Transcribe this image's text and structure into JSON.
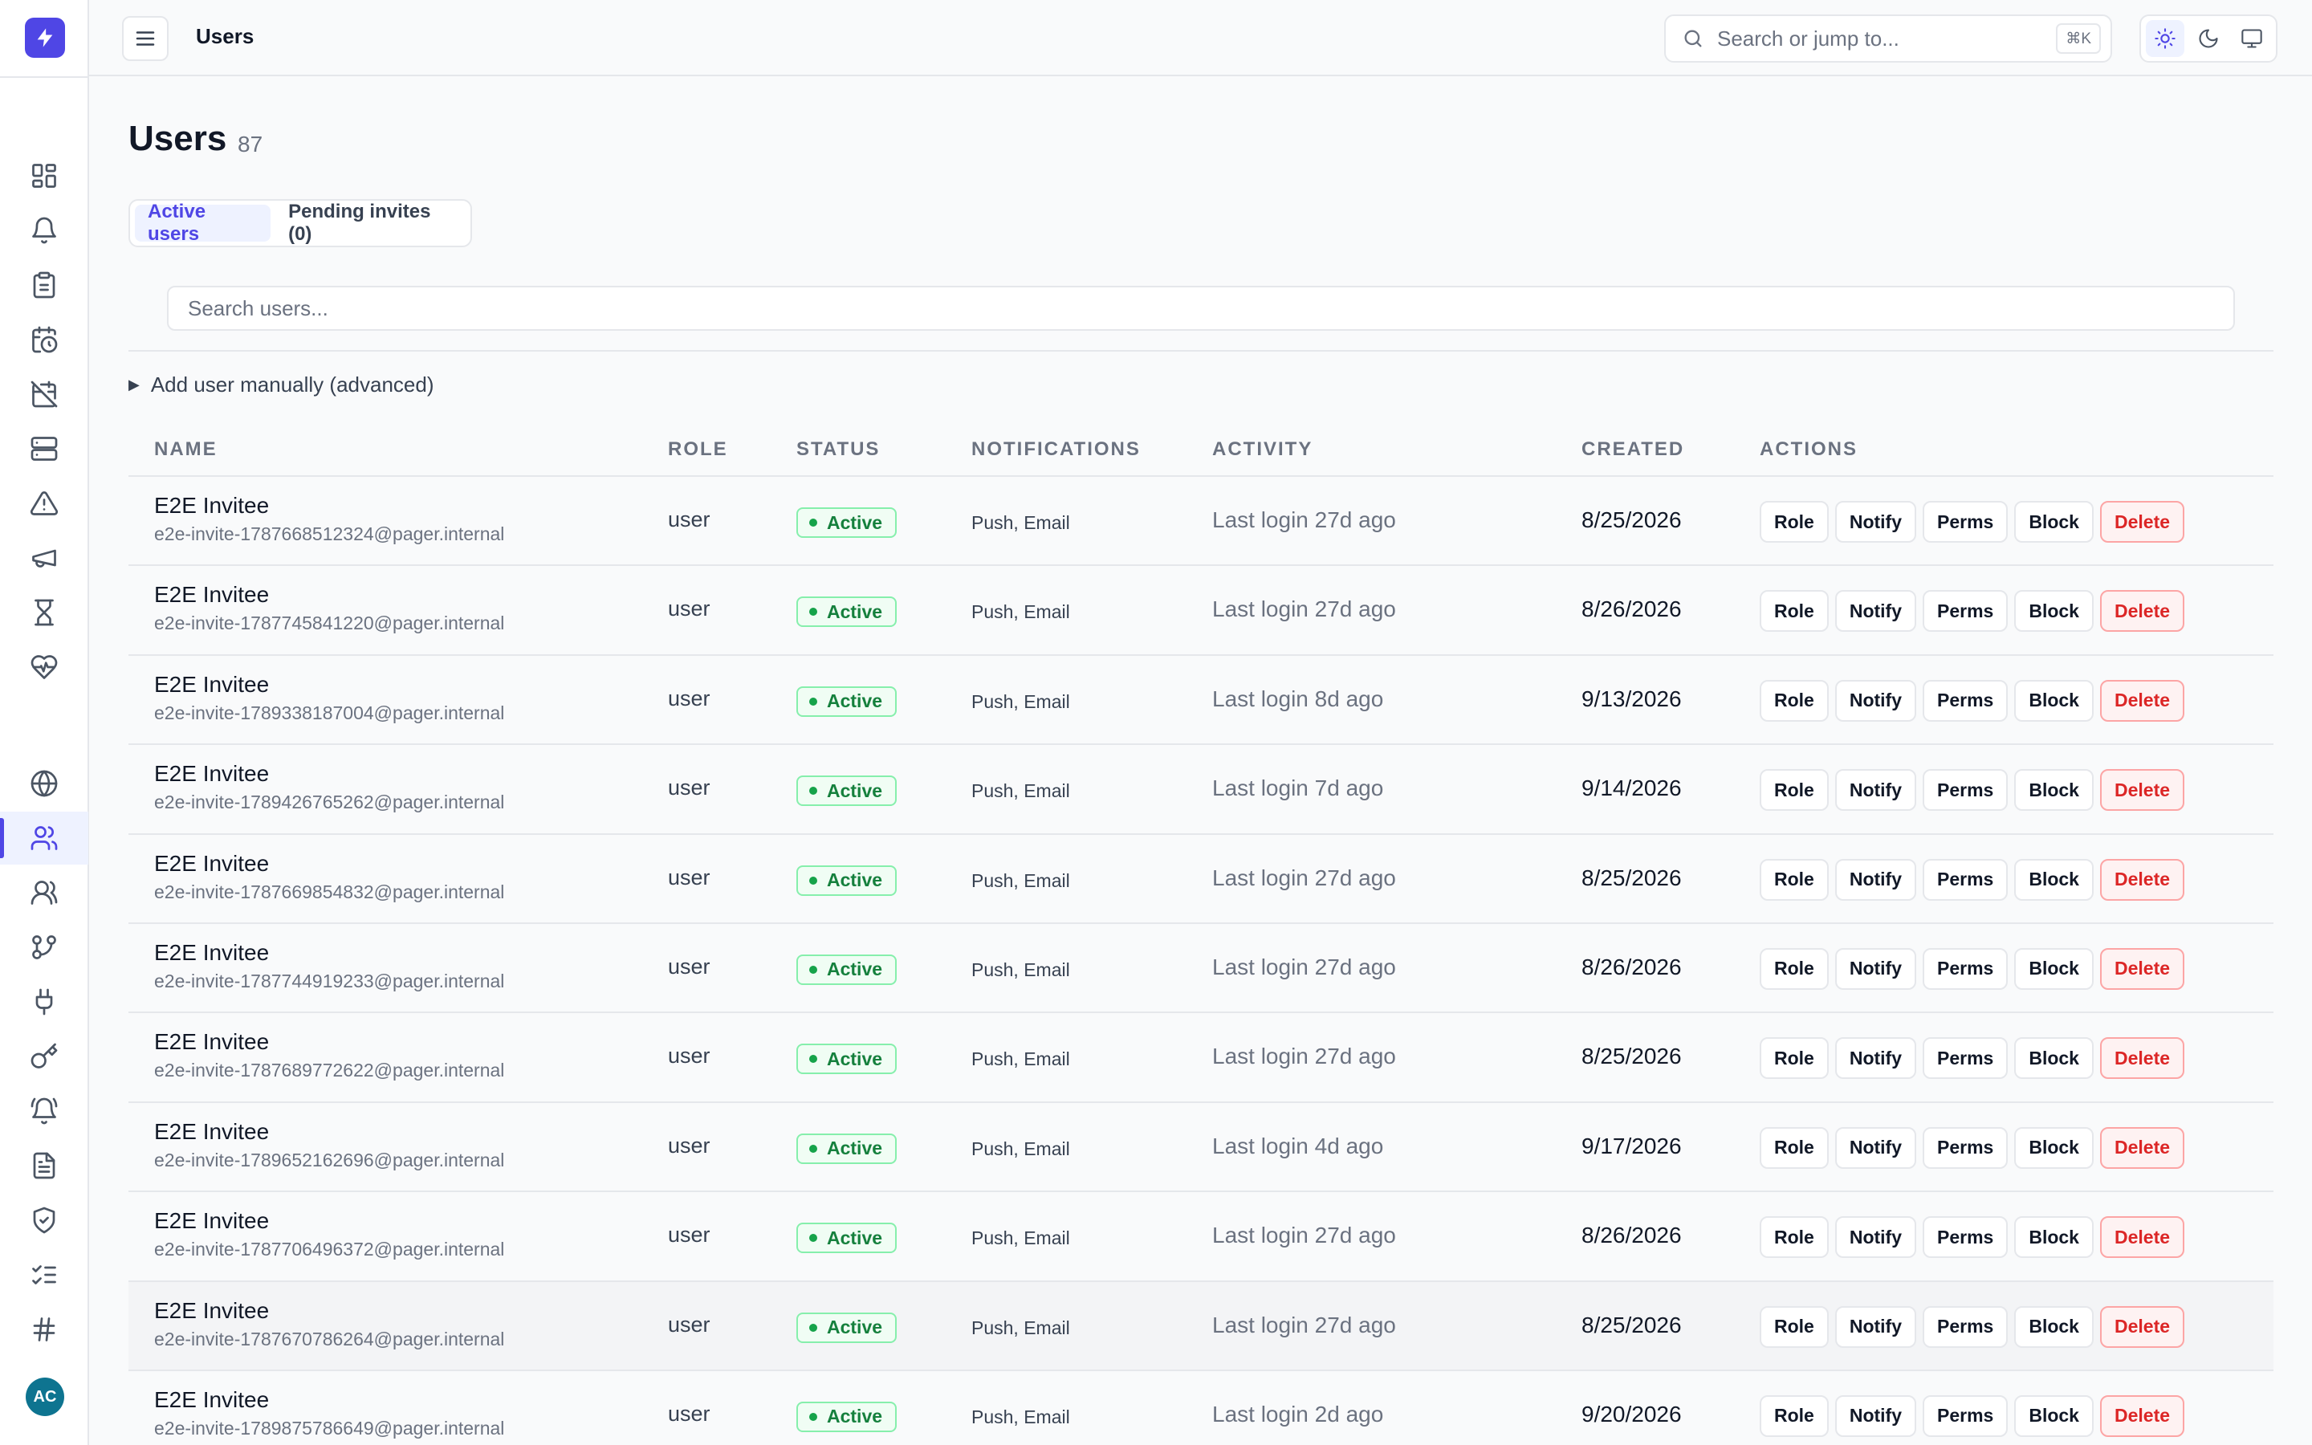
{
  "topbar": {
    "title": "Users",
    "search_placeholder": "Search or jump to...",
    "shortcut": "⌘K"
  },
  "sidebar": {
    "nav_icons": [
      "dashboard-icon",
      "bell-icon",
      "clipboard-icon",
      "calendar-clock-icon",
      "calendar-off-icon",
      "server-icon",
      "alert-triangle-icon",
      "megaphone-icon",
      "hourglass-icon",
      "heart-pulse-icon",
      "globe-icon",
      "users-icon",
      "team-icon",
      "git-branch-icon",
      "plug-icon",
      "key-icon",
      "bell-ring-icon",
      "file-text-icon",
      "shield-check-icon",
      "list-checks-icon",
      "hash-icon"
    ],
    "active": "users-icon",
    "avatar_initials": "AC"
  },
  "page": {
    "title": "Users",
    "count": "87"
  },
  "tabs": [
    {
      "label": "Active users",
      "active": true
    },
    {
      "label": "Pending invites (0)",
      "active": false
    }
  ],
  "search": {
    "placeholder": "Search users..."
  },
  "add_user_label": "Add user manually (advanced)",
  "table": {
    "headers": [
      "NAME",
      "ROLE",
      "STATUS",
      "NOTIFICATIONS",
      "ACTIVITY",
      "CREATED",
      "ACTIONS"
    ],
    "actions": [
      "Role",
      "Notify",
      "Perms",
      "Block",
      "Delete"
    ],
    "rows": [
      {
        "name": "E2E Invitee",
        "email": "e2e-invite-1787668512324@pager.internal",
        "role": "user",
        "status": "Active",
        "notifications": "Push, Email",
        "activity": "Last login 27d ago",
        "created": "8/25/2026"
      },
      {
        "name": "E2E Invitee",
        "email": "e2e-invite-1787745841220@pager.internal",
        "role": "user",
        "status": "Active",
        "notifications": "Push, Email",
        "activity": "Last login 27d ago",
        "created": "8/26/2026"
      },
      {
        "name": "E2E Invitee",
        "email": "e2e-invite-1789338187004@pager.internal",
        "role": "user",
        "status": "Active",
        "notifications": "Push, Email",
        "activity": "Last login 8d ago",
        "created": "9/13/2026"
      },
      {
        "name": "E2E Invitee",
        "email": "e2e-invite-1789426765262@pager.internal",
        "role": "user",
        "status": "Active",
        "notifications": "Push, Email",
        "activity": "Last login 7d ago",
        "created": "9/14/2026"
      },
      {
        "name": "E2E Invitee",
        "email": "e2e-invite-1787669854832@pager.internal",
        "role": "user",
        "status": "Active",
        "notifications": "Push, Email",
        "activity": "Last login 27d ago",
        "created": "8/25/2026"
      },
      {
        "name": "E2E Invitee",
        "email": "e2e-invite-1787744919233@pager.internal",
        "role": "user",
        "status": "Active",
        "notifications": "Push, Email",
        "activity": "Last login 27d ago",
        "created": "8/26/2026"
      },
      {
        "name": "E2E Invitee",
        "email": "e2e-invite-1787689772622@pager.internal",
        "role": "user",
        "status": "Active",
        "notifications": "Push, Email",
        "activity": "Last login 27d ago",
        "created": "8/25/2026"
      },
      {
        "name": "E2E Invitee",
        "email": "e2e-invite-1789652162696@pager.internal",
        "role": "user",
        "status": "Active",
        "notifications": "Push, Email",
        "activity": "Last login 4d ago",
        "created": "9/17/2026"
      },
      {
        "name": "E2E Invitee",
        "email": "e2e-invite-1787706496372@pager.internal",
        "role": "user",
        "status": "Active",
        "notifications": "Push, Email",
        "activity": "Last login 27d ago",
        "created": "8/26/2026"
      },
      {
        "name": "E2E Invitee",
        "email": "e2e-invite-1787670786264@pager.internal",
        "role": "user",
        "status": "Active",
        "notifications": "Push, Email",
        "activity": "Last login 27d ago",
        "created": "8/25/2026",
        "highlighted": true
      },
      {
        "name": "E2E Invitee",
        "email": "e2e-invite-1789875786649@pager.internal",
        "role": "user",
        "status": "Active",
        "notifications": "Push, Email",
        "activity": "Last login 2d ago",
        "created": "9/20/2026"
      }
    ]
  },
  "colors": {
    "accent": "#4f46e5",
    "status_active": "#15803d",
    "danger": "#dc2626",
    "avatar": "#0e7490"
  }
}
